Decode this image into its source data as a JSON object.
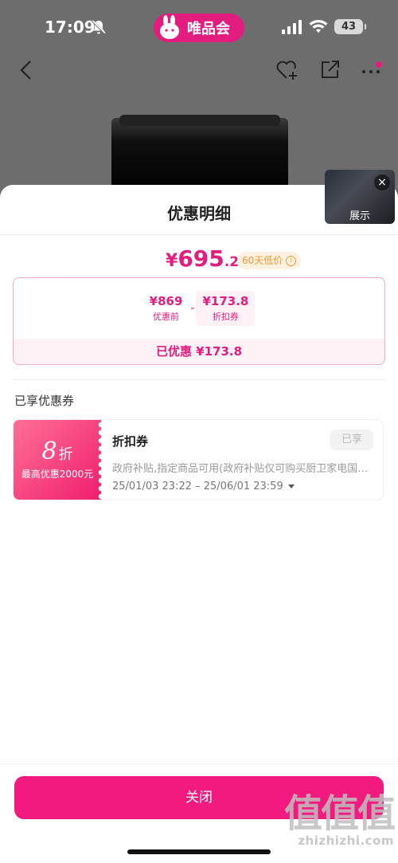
{
  "status_bar": {
    "time": "17:09",
    "battery": "43"
  },
  "brand": {
    "name": "唯品会"
  },
  "video": {
    "label": "展示"
  },
  "sheet": {
    "title": "优惠明细",
    "final_price": {
      "currency": "¥",
      "integer": "695",
      "decimal": ".2"
    },
    "low_price_badge": "60天低价",
    "breakdown": {
      "original": {
        "value": "¥869",
        "label": "优惠前"
      },
      "operator": "-",
      "coupon": {
        "value": "¥173.8",
        "label": "折扣券"
      },
      "saved": "已优惠 ¥173.8"
    },
    "section_title": "已享优惠券",
    "coupon": {
      "discount": "8",
      "discount_unit": "折",
      "max_discount": "最高优惠2000元",
      "name": "折扣券",
      "status": "已享",
      "description": "政府补贴,指定商品可用(政府补贴仅可购买厨卫家电国家…",
      "dates": "25/01/03 23:22 – 25/06/01 23:59"
    },
    "close_label": "关闭"
  },
  "watermark": {
    "big": "值值值",
    "url": "zhizhizhi.com"
  }
}
